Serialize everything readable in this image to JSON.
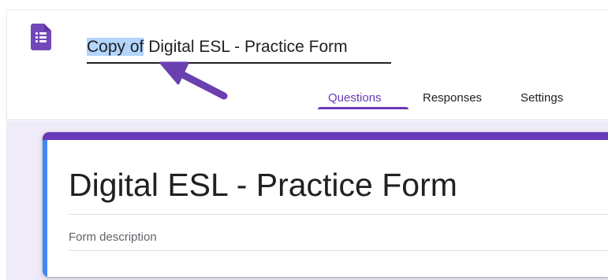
{
  "header": {
    "title_selected_part": "Copy of",
    "title_rest": " Digital ESL - Practice Form"
  },
  "tabs": [
    {
      "label": "Questions",
      "active": true
    },
    {
      "label": "Responses",
      "active": false
    },
    {
      "label": "Settings",
      "active": false
    }
  ],
  "form": {
    "title": "Digital ESL - Practice Form",
    "description_placeholder": "Form description"
  },
  "icons": {
    "app_logo": "google-forms-icon",
    "annotation": "arrow-icon"
  },
  "colors": {
    "accent": "#673ab7",
    "logo": "#7248b9",
    "canvas": "#f0ebf8",
    "selection": "#b3d4fc",
    "left_bar": "#4285f4",
    "arrow": "#6a3fb0"
  }
}
